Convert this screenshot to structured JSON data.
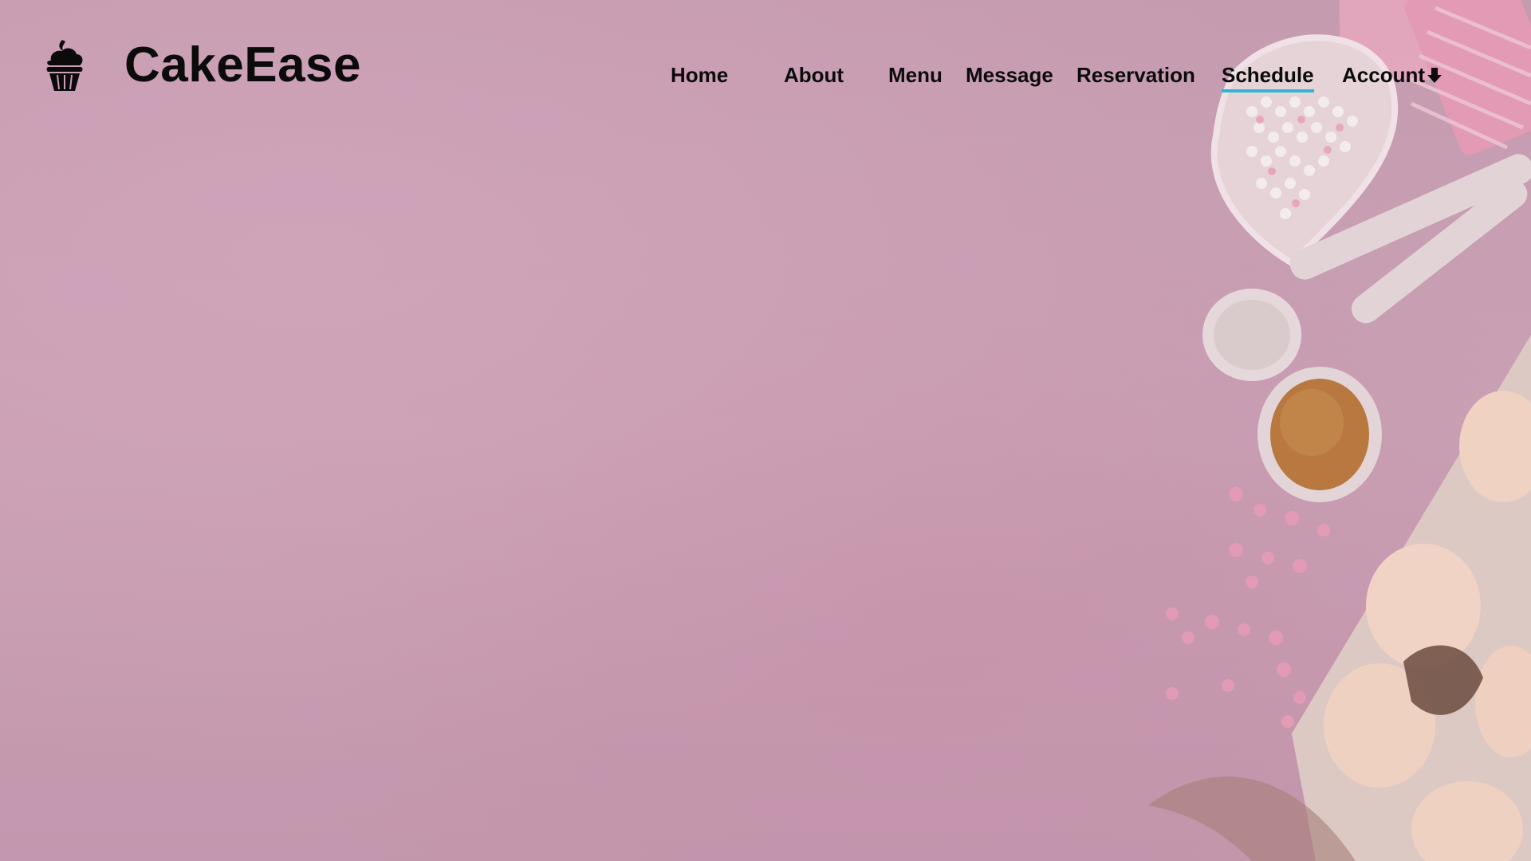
{
  "brand": {
    "name": "CakeEase",
    "icon": "cupcake-icon"
  },
  "nav": {
    "items": [
      {
        "label": "Home"
      },
      {
        "label": "About"
      },
      {
        "label": "Menu"
      },
      {
        "label": "Message"
      },
      {
        "label": "Reservation"
      },
      {
        "label": "Schedule",
        "active": true
      }
    ],
    "account": {
      "label": "Account",
      "icon": "arrow-down-icon"
    }
  },
  "colors": {
    "background": "#c89db1",
    "text": "#0b0b0b",
    "active_underline": "#2bb6d6"
  }
}
